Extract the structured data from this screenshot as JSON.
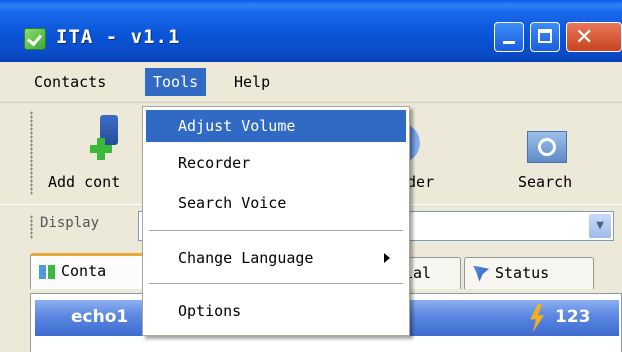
{
  "window": {
    "title": "ITA - v1.1"
  },
  "menubar": {
    "contacts": "Contacts",
    "tools": "Tools",
    "help": "Help"
  },
  "toolbar": {
    "add_contact_label": "Add cont",
    "recorder_label": "rder",
    "search_label": "Search"
  },
  "display": {
    "label": "Display"
  },
  "tabs": {
    "contacts": "Conta",
    "dial": "ial",
    "status": "Status"
  },
  "contact_list": [
    {
      "name": "echo1",
      "count": "123"
    }
  ],
  "tools_menu": {
    "items": [
      "Adjust Volume",
      "Recorder",
      "Search Voice",
      "Change Language",
      "Options"
    ],
    "highlighted": "Adjust Volume"
  },
  "colors": {
    "titlebar": "#0A55D8",
    "highlight": "#316AC5",
    "background": "#ECE9D8"
  }
}
